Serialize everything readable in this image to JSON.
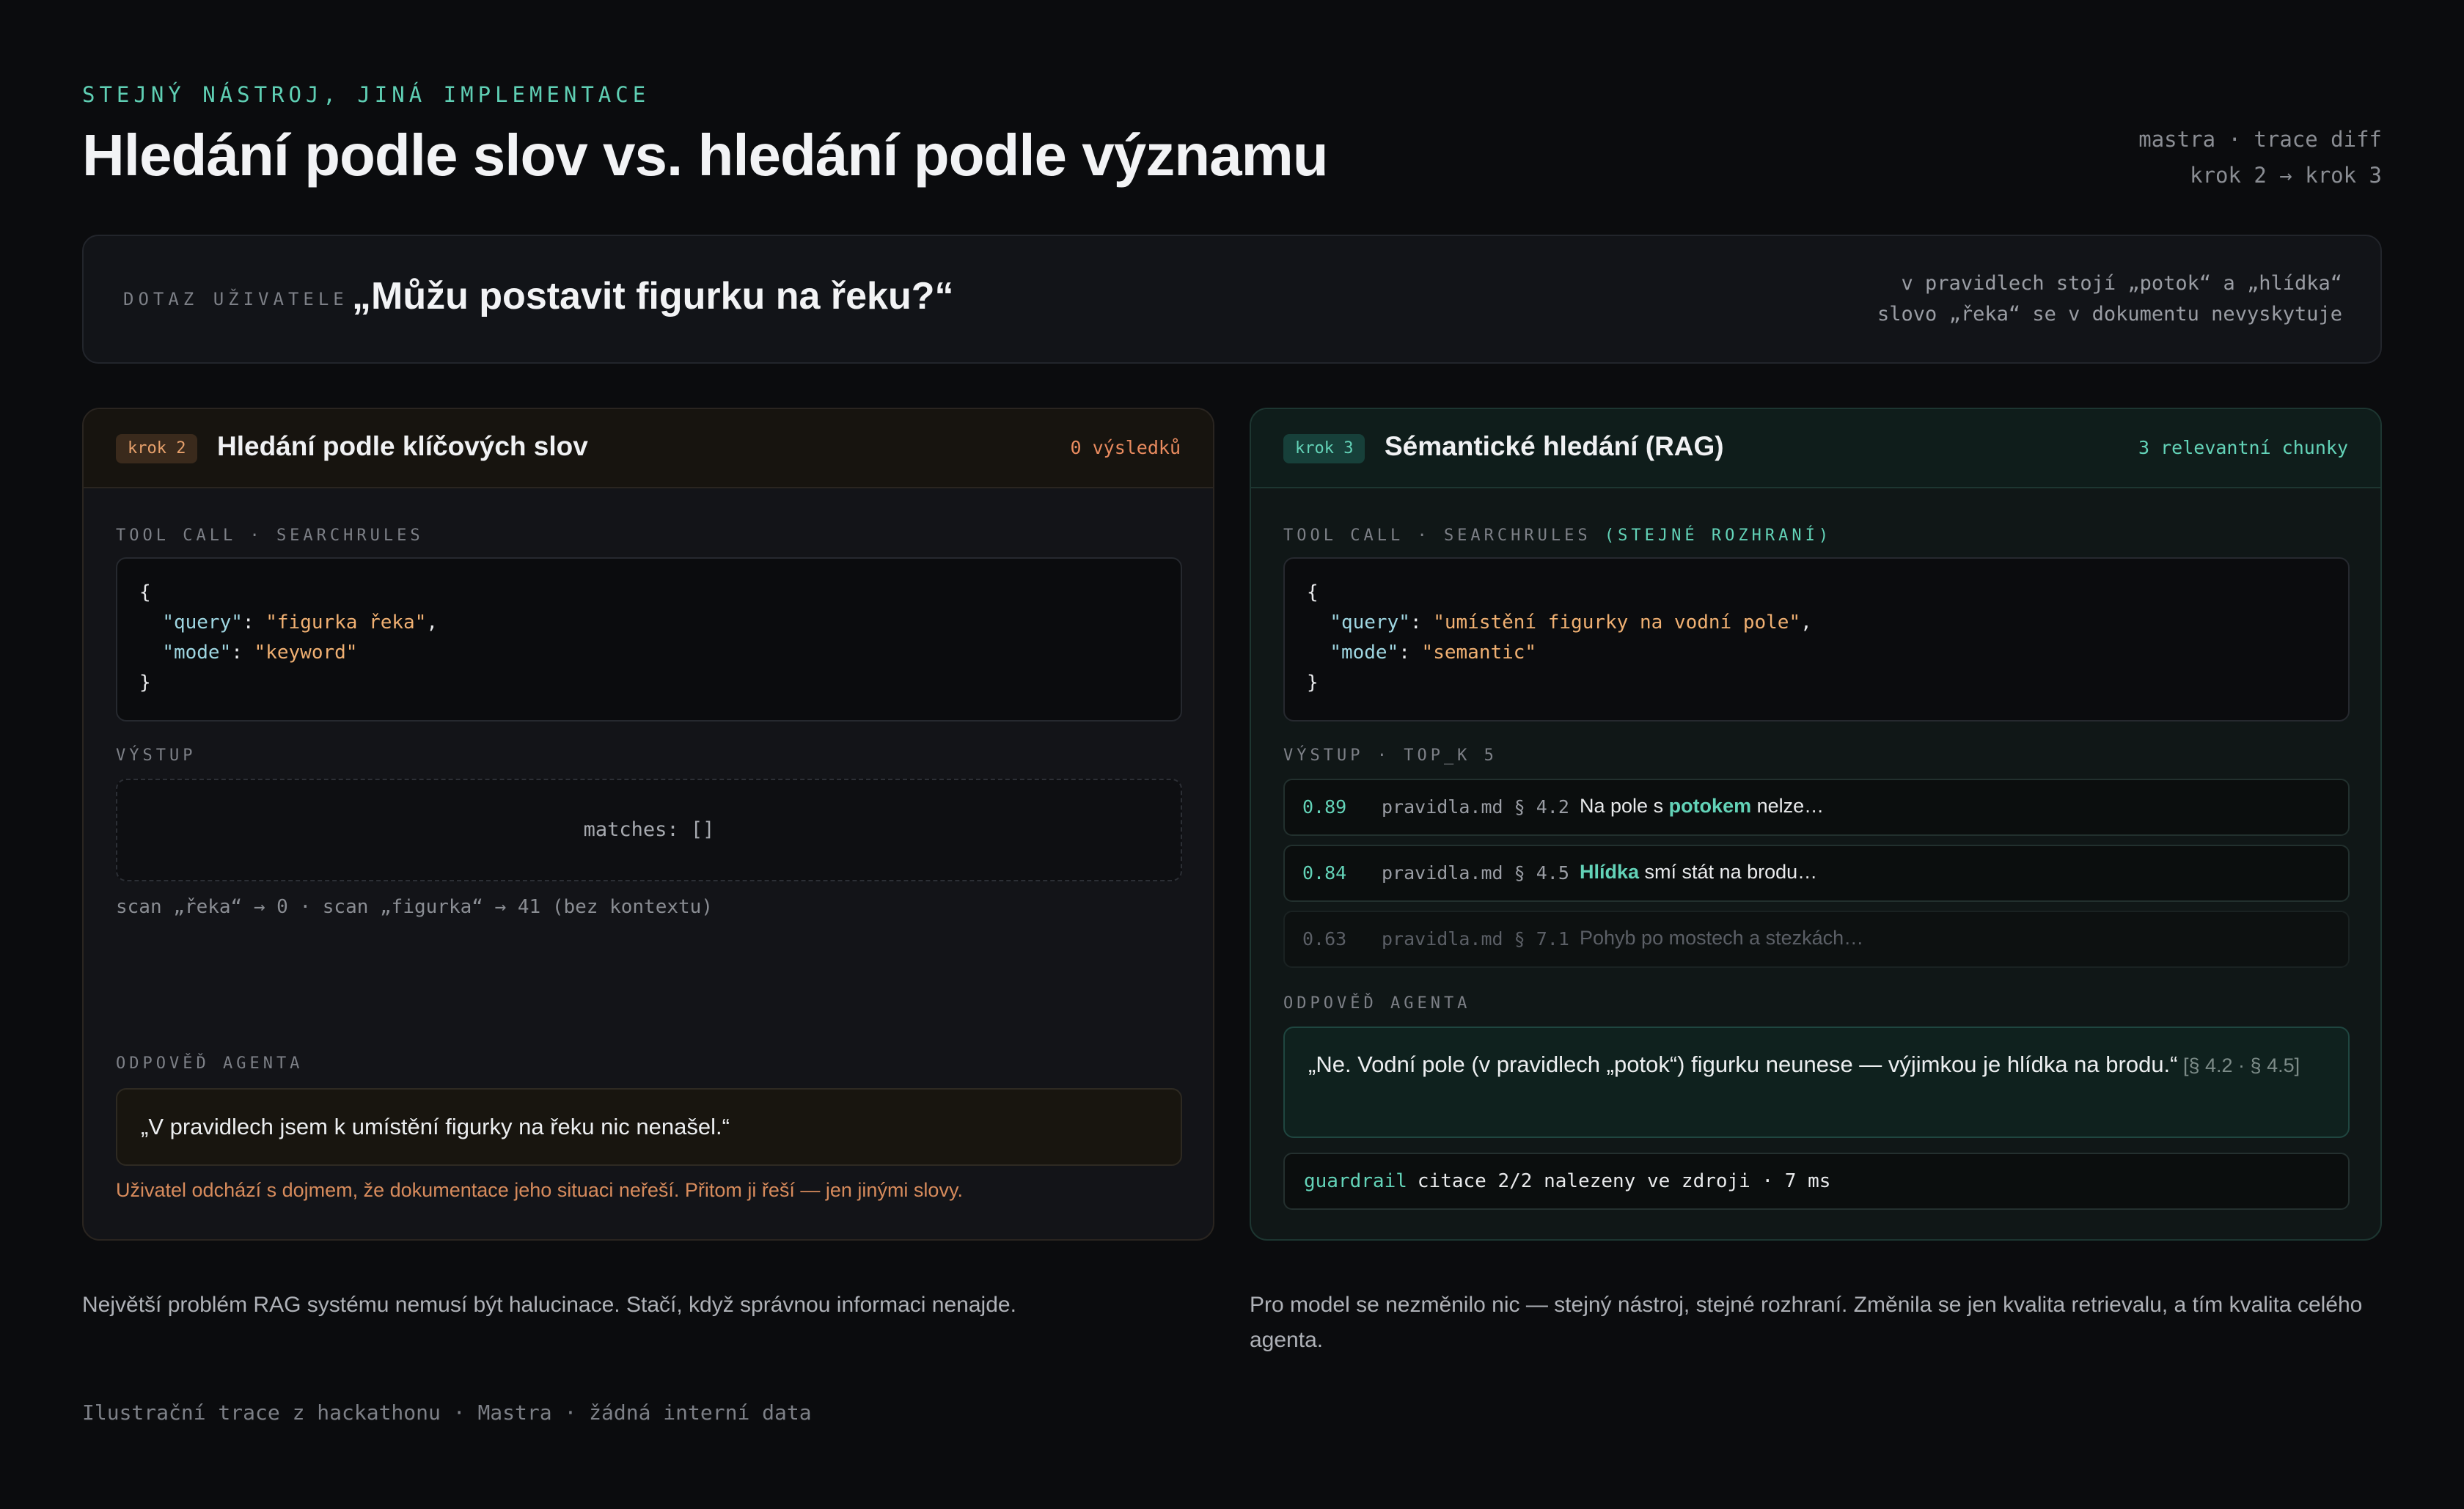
{
  "header": {
    "eyebrow": "STEJNÝ NÁSTROJ, JINÁ IMPLEMENTACE",
    "title": "Hledání podle slov vs. hledání podle významu",
    "meta_line1": "mastra · trace diff",
    "meta_line2": "krok 2 → krok 3"
  },
  "query": {
    "label": "DOTAZ UŽIVATELE",
    "text": "„Můžu postavit figurku na řeku?“",
    "note_line1": "v pravidlech stojí „potok“ a „hlídka“",
    "note_line2": "slovo „řeka“ se v dokumentu nevyskytuje"
  },
  "left": {
    "badge": "krok 2",
    "title": "Hledání podle klíčových slov",
    "count": "0 výsledků",
    "tool_label": "TOOL CALL · SEARCHRULES",
    "code": {
      "open": "{",
      "query_key": "\"query\"",
      "query_val": "\"figurka řeka\"",
      "mode_key": "\"mode\"",
      "mode_val": "\"keyword\"",
      "close": "}"
    },
    "output_label": "VÝSTUP",
    "output": "matches: []",
    "scan": "scan „řeka“ → 0 · scan „figurka“ → 41 (bez kontextu)",
    "answer_label": "ODPOVĚĎ AGENTA",
    "answer": "„V pravidlech jsem k umístění figurky na řeku nic nenašel.“",
    "note": "Uživatel odchází s dojmem, že dokumentace jeho situaci neřeší. Přitom ji řeší — jen jinými slovy."
  },
  "right": {
    "badge": "krok 3",
    "title": "Sémantické hledání (RAG)",
    "count": "3 relevantní chunky",
    "tool_label": "TOOL CALL · SEARCHRULES",
    "tool_label_accent": "(STEJNÉ ROZHRANÍ)",
    "code": {
      "open": "{",
      "query_key": "\"query\"",
      "query_val": "\"umístění figurky na vodní pole\"",
      "mode_key": "\"mode\"",
      "mode_val": "\"semantic\"",
      "close": "}"
    },
    "output_label": "VÝSTUP · TOP_K 5",
    "results": [
      {
        "score": "0.89",
        "source": "pravidla.md § 4.2",
        "pre": "Na pole s ",
        "highlight": "potokem",
        "post": " nelze…"
      },
      {
        "score": "0.84",
        "source": "pravidla.md § 4.5",
        "pre": "",
        "highlight": "Hlídka",
        "post": " smí stát na brodu…"
      },
      {
        "score": "0.63",
        "source": "pravidla.md § 7.1",
        "pre": "Pohyb po mostech a stezkách…",
        "highlight": "",
        "post": ""
      }
    ],
    "answer_label": "ODPOVĚĎ AGENTA",
    "answer": "„Ne. Vodní pole (v pravidlech „potok“) figurku neunese — výjimkou je hlídka na brodu.“",
    "answer_cite": " [§ 4.2 · § 4.5]",
    "guard_tag": "guardrail",
    "guard_text": "citace 2/2 nalezeny ve zdroji · 7 ms"
  },
  "bottom": {
    "left": "Největší problém RAG systému nemusí být halucinace. Stačí, když správnou informaci nenajde.",
    "right": "Pro model se nezměnilo nic — stejný nástroj, stejné rozhraní. Změnila se jen kvalita retrievalu, a tím kvalita celého agenta.",
    "footer": "Ilustrační trace z hackathonu · Mastra · žádná interní data"
  }
}
